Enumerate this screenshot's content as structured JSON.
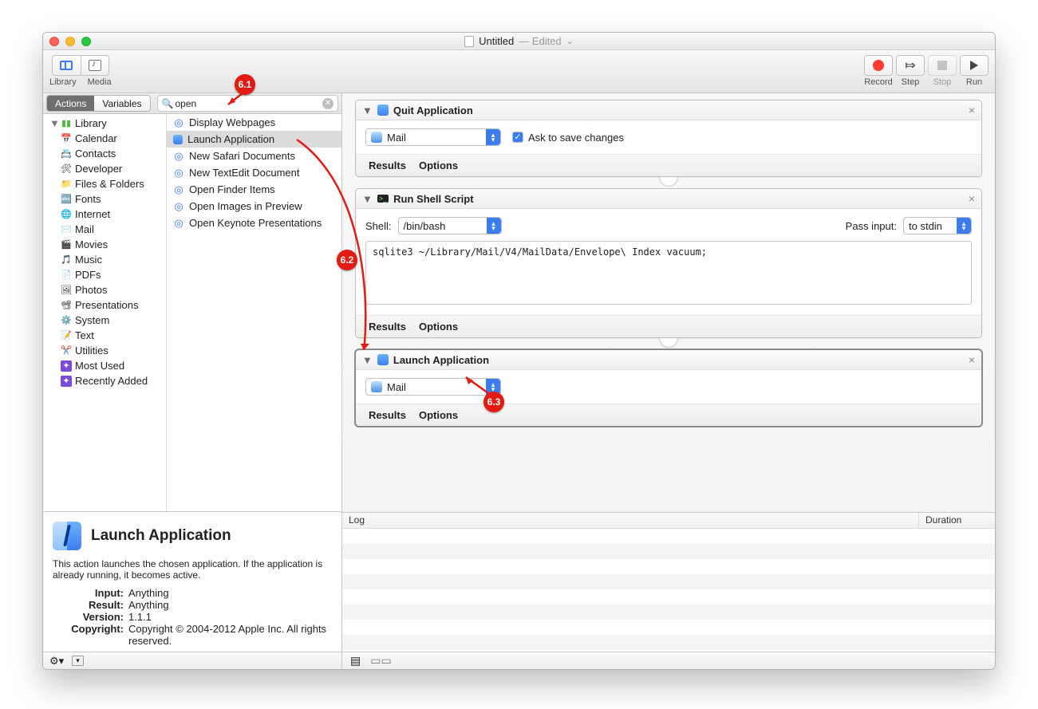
{
  "title": {
    "name": "Untitled",
    "suffix": "— Edited"
  },
  "toolbar": {
    "library": "Library",
    "media": "Media",
    "record": "Record",
    "step": "Step",
    "stop": "Stop",
    "run": "Run"
  },
  "tabs": {
    "actions": "Actions",
    "variables": "Variables"
  },
  "search": {
    "value": "open"
  },
  "library": {
    "root": "Library",
    "items": [
      "Calendar",
      "Contacts",
      "Developer",
      "Files & Folders",
      "Fonts",
      "Internet",
      "Mail",
      "Movies",
      "Music",
      "PDFs",
      "Photos",
      "Presentations",
      "System",
      "Text",
      "Utilities"
    ],
    "extras": [
      "Most Used",
      "Recently Added"
    ]
  },
  "actions": [
    "Display Webpages",
    "Launch Application",
    "New Safari Documents",
    "New TextEdit Document",
    "Open Finder Items",
    "Open Images in Preview",
    "Open Keynote Presentations"
  ],
  "actions_selected_index": 1,
  "info": {
    "title": "Launch Application",
    "desc": "This action launches the chosen application. If the application is already running, it becomes active.",
    "input_k": "Input:",
    "input_v": "Anything",
    "result_k": "Result:",
    "result_v": "Anything",
    "version_k": "Version:",
    "version_v": "1.1.1",
    "copyright_k": "Copyright:",
    "copyright_v": "Copyright © 2004-2012 Apple Inc.  All rights reserved."
  },
  "workflow": {
    "a1": {
      "title": "Quit Application",
      "app": "Mail",
      "ask_label": "Ask to save changes"
    },
    "a2": {
      "title": "Run Shell Script",
      "shell_label": "Shell:",
      "shell": "/bin/bash",
      "pass_label": "Pass input:",
      "pass": "to stdin",
      "script": "sqlite3 ~/Library/Mail/V4/MailData/Envelope\\ Index vacuum;"
    },
    "a3": {
      "title": "Launch Application",
      "app": "Mail"
    },
    "foot": {
      "results": "Results",
      "options": "Options"
    }
  },
  "log": {
    "log": "Log",
    "duration": "Duration"
  },
  "markers": {
    "m1": "6.1",
    "m2": "6.2",
    "m3": "6.3"
  }
}
